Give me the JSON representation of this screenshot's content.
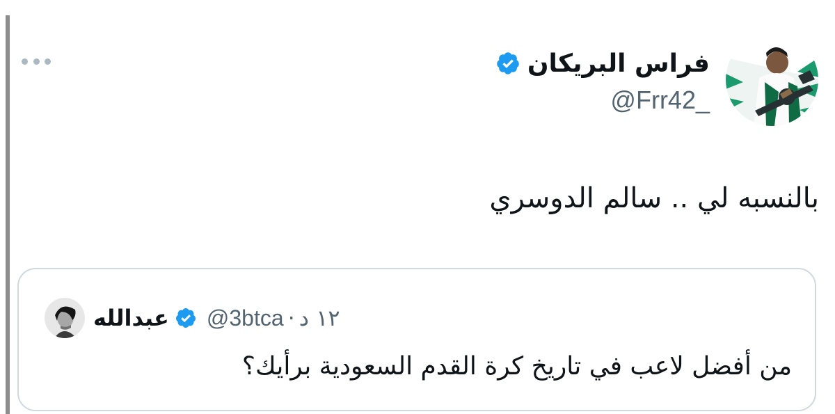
{
  "author": {
    "display_name": "فراس البريكان",
    "handle": "@Frr42_",
    "verified": true
  },
  "tweet": {
    "text": "بالنسبه لي .. سالم الدوسري"
  },
  "quoted_tweet": {
    "display_name": "عبدالله",
    "handle": "@3btca",
    "separator": "·",
    "time": "١٢ د",
    "verified": true,
    "text": "من أفضل لاعب في تاريخ كرة القدم السعودية برأيك؟"
  },
  "colors": {
    "verified_blue": "#1d9bf0",
    "text_primary": "#0f1419",
    "text_secondary": "#536471",
    "border": "#cfd9de"
  },
  "icons": {
    "more": "more-dots-icon",
    "verified": "verified-badge-icon"
  }
}
